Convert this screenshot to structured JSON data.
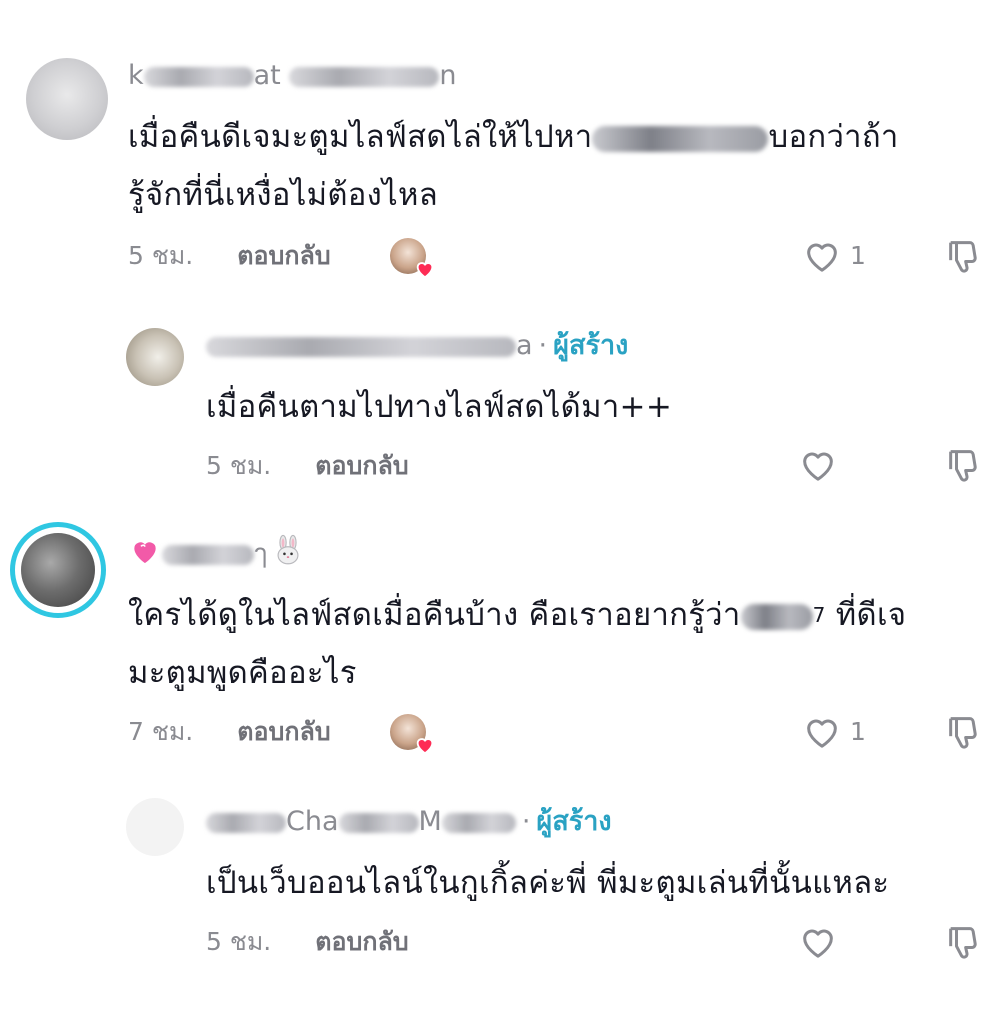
{
  "comments": [
    {
      "username_visible": "k      at S       n",
      "text_part1": "เมื่อคืนดีเจมะตูมไลฟ์สดไล่ให้ไปหา",
      "text_part2": "บอกว่าถ้า",
      "text_line2": "รู้จักที่นี่เหงื่อไม่ต้องไหล",
      "time": "5 ชม.",
      "reply_label": "ตอบกลับ",
      "like_count": "1",
      "reply": {
        "username_suffix": "a",
        "creator_label": "ผู้สร้าง",
        "text": "เมื่อคืนตามไปทางไลฟ์สดได้มา++",
        "time": "5 ชม.",
        "reply_label": "ตอบกลับ"
      }
    },
    {
      "text_part1": "ใครได้ดูในไลฟ์สดเมื่อคืนบ้าง คือเราอยากรู้ว่า",
      "text_part2": "ที่ดีเจ",
      "text_line2": "มะตูมพูดคืออะไร",
      "redacted_suffix": "7",
      "time": "7 ชม.",
      "reply_label": "ตอบกลับ",
      "like_count": "1",
      "reply": {
        "username_mid": "Cha",
        "username_mid2": "M",
        "creator_label": "ผู้สร้าง",
        "text": "เป็นเว็บออนไลน์ในกูเกิ้ลค่ะพี่ พี่มะตูมเล่นที่นั้นแหละ",
        "time": "5 ชม.",
        "reply_label": "ตอบกลับ"
      }
    }
  ],
  "icons": {
    "heart": "heart-outline-icon",
    "dislike": "thumbs-down-icon",
    "liked_by_creator": "creator-liked-heart-icon",
    "heart_emoji": "pink-heart-emoji",
    "rabbit_emoji": "rabbit-face-emoji"
  },
  "colors": {
    "creator_label": "#2aa2c3",
    "avatar_ring": "#2fc7e2",
    "heart_badge": "#fe2c55",
    "muted_text": "#8a8b91"
  }
}
